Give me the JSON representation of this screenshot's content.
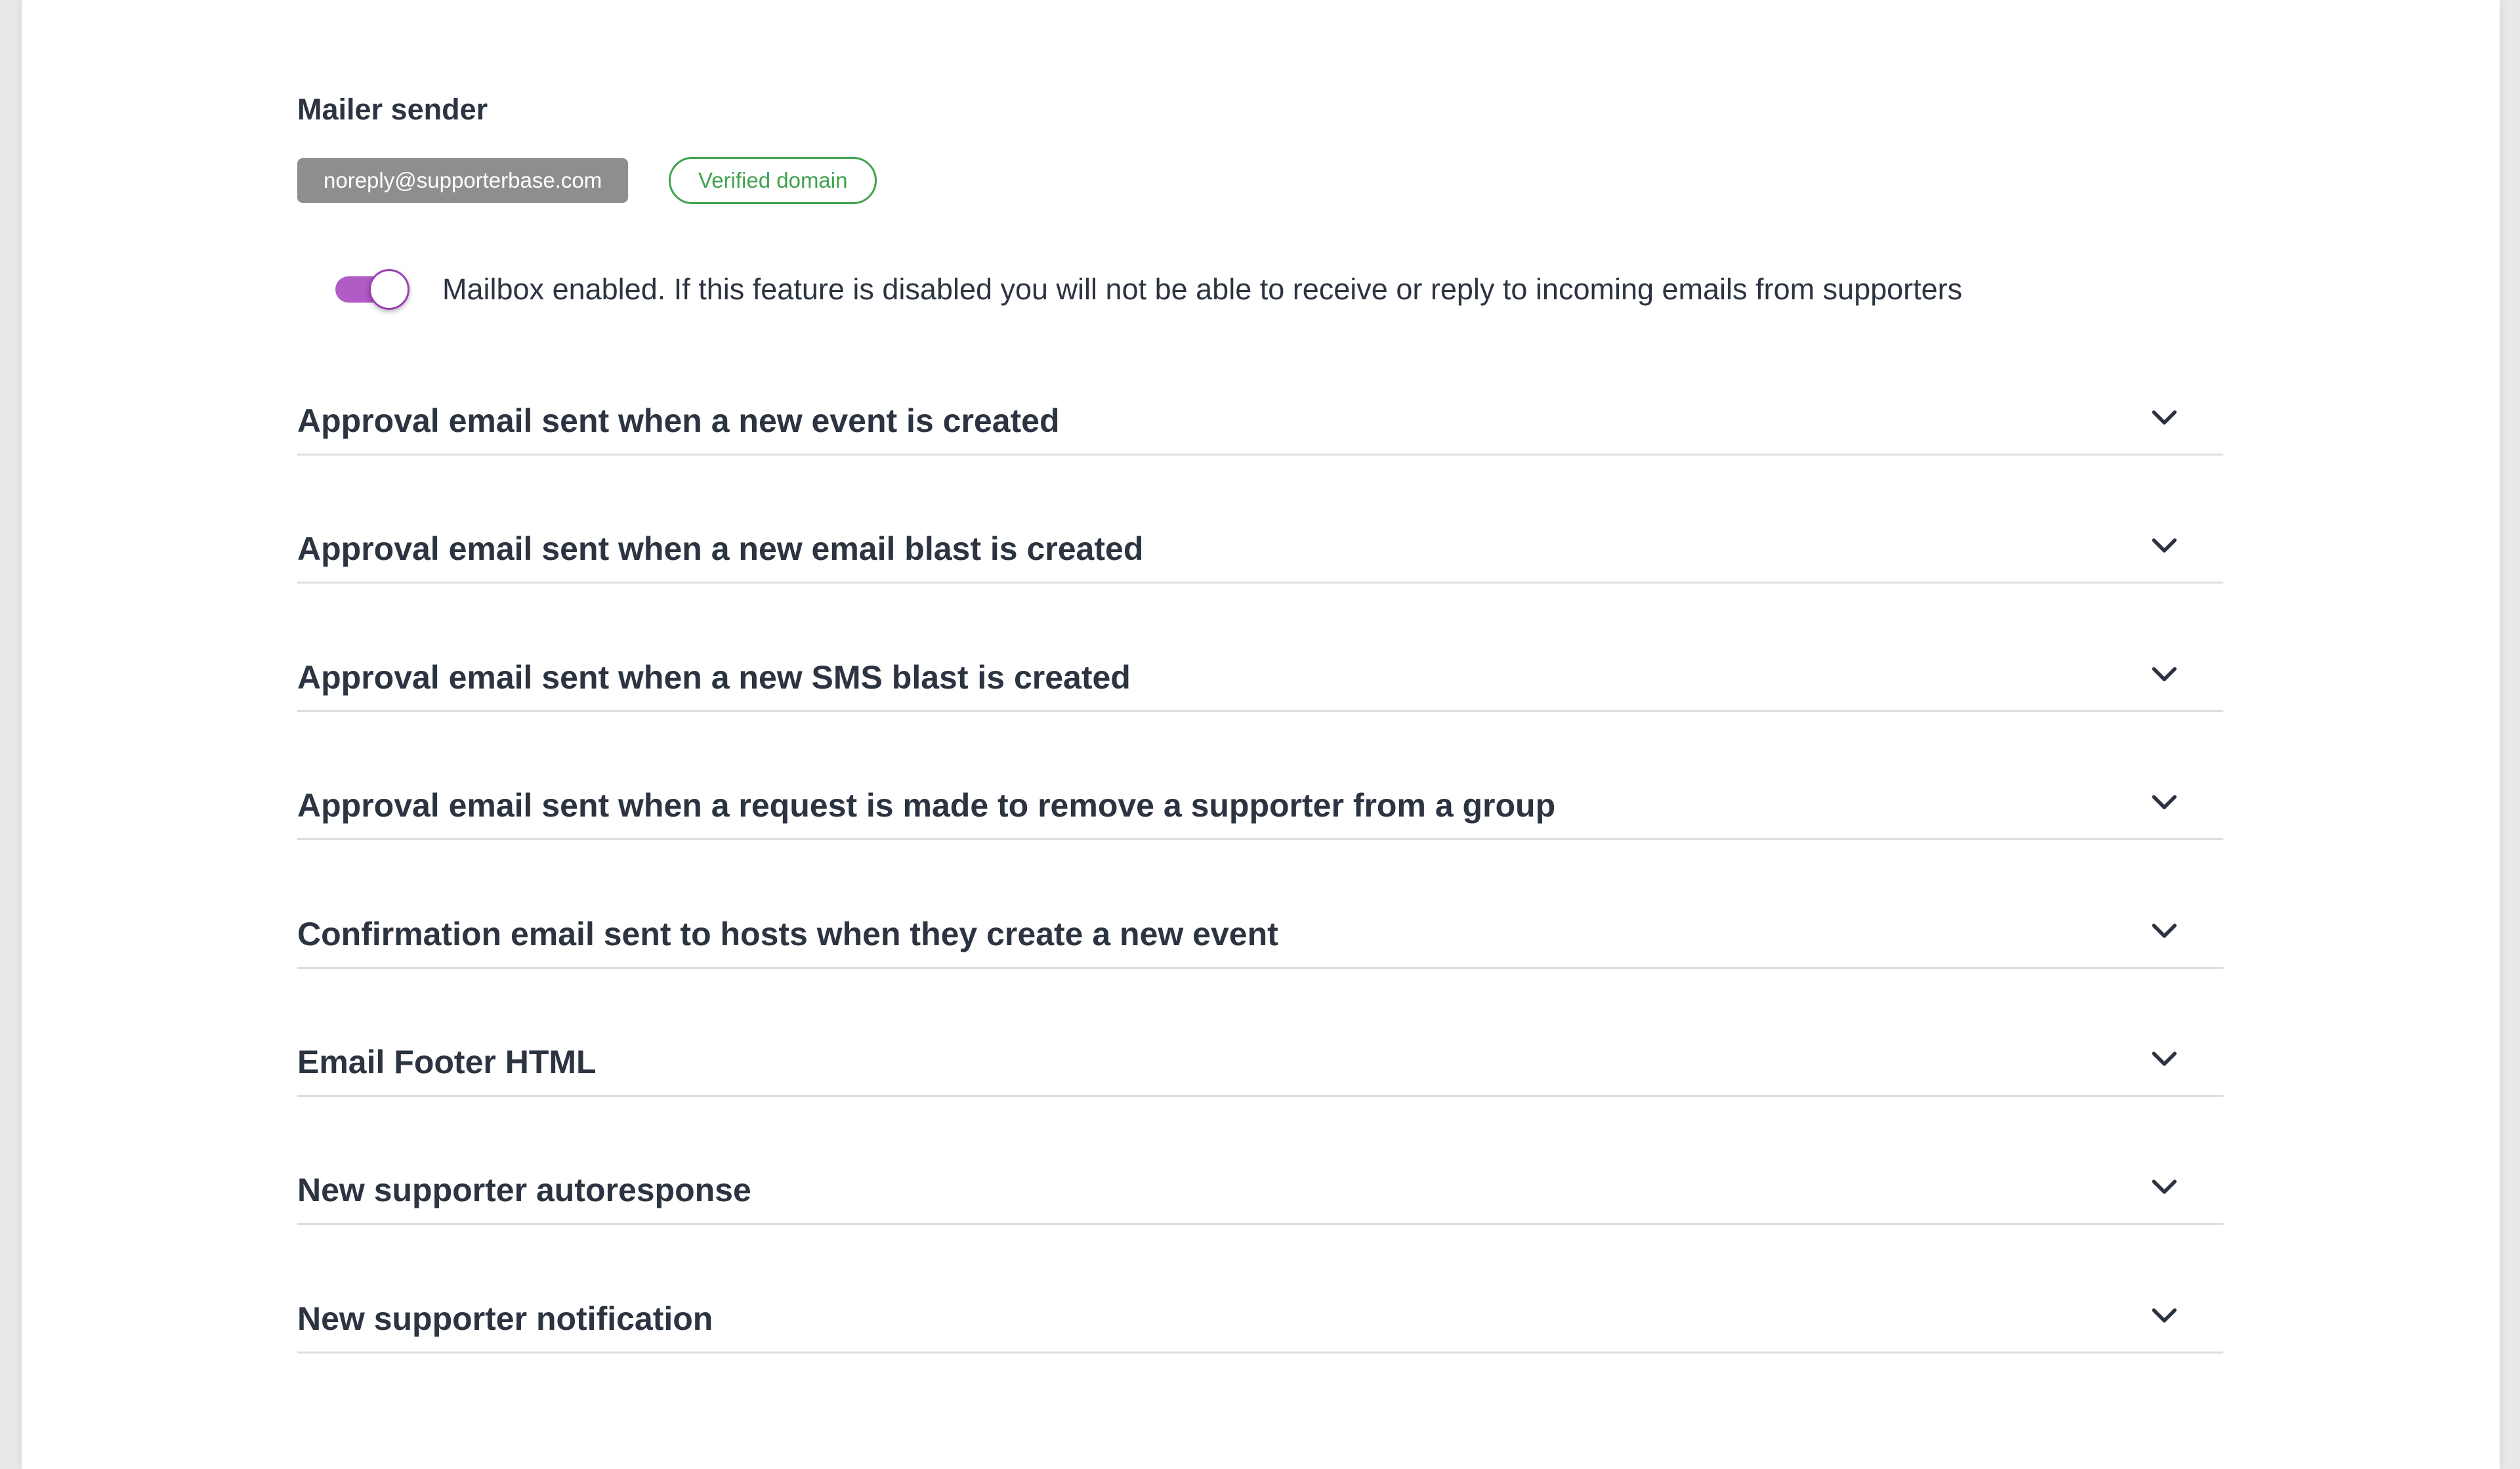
{
  "mailer": {
    "title": "Mailer sender",
    "sender_email": "noreply@supporterbase.com",
    "verified_label": "Verified domain",
    "verified_color": "#3fa34d"
  },
  "mailbox": {
    "enabled": true,
    "label": "Mailbox enabled. If this feature is disabled you will not be able to receive or reply to incoming emails from supporters",
    "toggle_color": "#b15bc7"
  },
  "accordion": {
    "items": [
      {
        "title": "Approval email sent when a new event is created",
        "icon": "chevron-down-icon"
      },
      {
        "title": "Approval email sent when a new email blast is created",
        "icon": "chevron-down-icon"
      },
      {
        "title": "Approval email sent when a new SMS blast is created",
        "icon": "chevron-down-icon"
      },
      {
        "title": "Approval email sent when a request is made to remove a supporter from a group",
        "icon": "chevron-down-icon"
      },
      {
        "title": "Confirmation email sent to hosts when they create a new event",
        "icon": "chevron-down-icon"
      },
      {
        "title": "Email Footer HTML",
        "icon": "chevron-down-icon"
      },
      {
        "title": "New supporter autoresponse",
        "icon": "chevron-down-icon"
      },
      {
        "title": "New supporter notification",
        "icon": "chevron-down-icon"
      }
    ]
  }
}
